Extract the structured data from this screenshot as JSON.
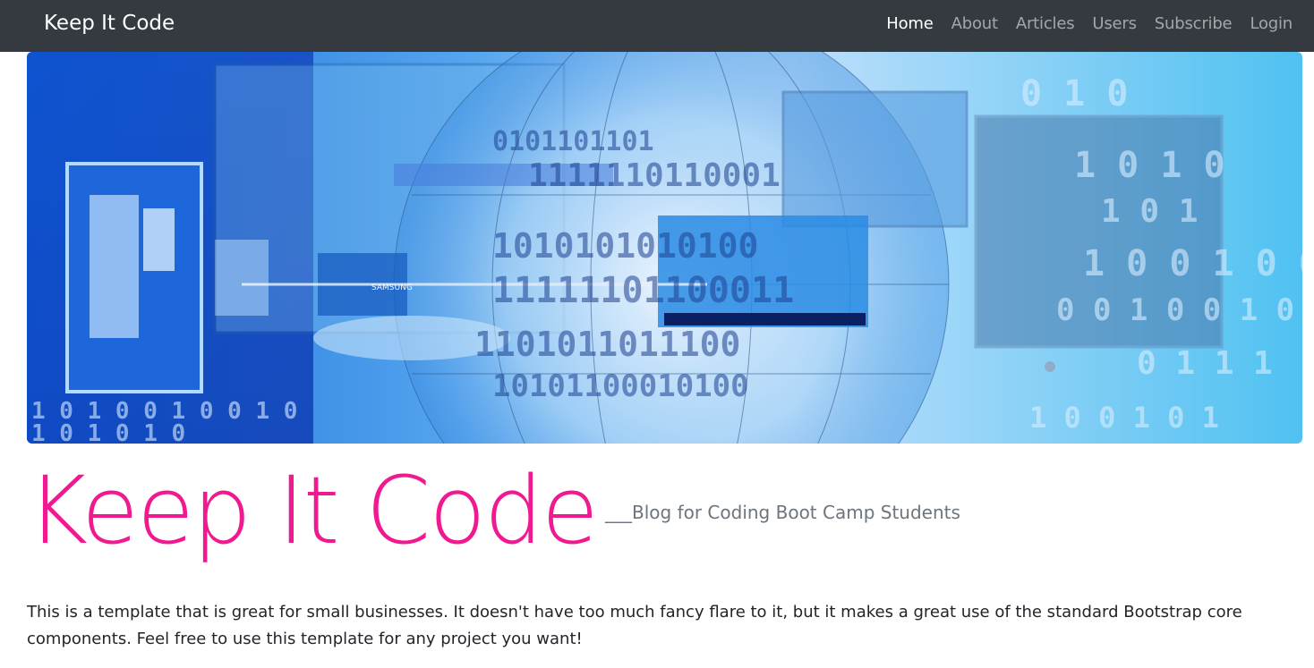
{
  "navbar": {
    "brand": "Keep It Code",
    "links": [
      {
        "label": "Home",
        "active": true
      },
      {
        "label": "About",
        "active": false
      },
      {
        "label": "Articles",
        "active": false
      },
      {
        "label": "Users",
        "active": false
      },
      {
        "label": "Subscribe",
        "active": false
      },
      {
        "label": "Login",
        "active": false
      }
    ]
  },
  "hero": {
    "image_label": "SAMSUNG",
    "binary_rows": [
      "0101101101",
      "1111110110001",
      "1010101010100",
      "11111101100011",
      "1101011011100",
      "10101100010100"
    ]
  },
  "main": {
    "title": "Keep It Code",
    "subtitle": "___Blog for Coding Boot Camp Students",
    "description": "This is a template that is great for small businesses. It doesn't have too much fancy flare to it, but it makes a great use of the standard Bootstrap core components. Feel free to use this template for any project you want!"
  },
  "colors": {
    "navbar_bg": "#343a40",
    "title_pink": "#f0198f",
    "subtitle_gray": "#6c757d",
    "text": "#212529"
  }
}
